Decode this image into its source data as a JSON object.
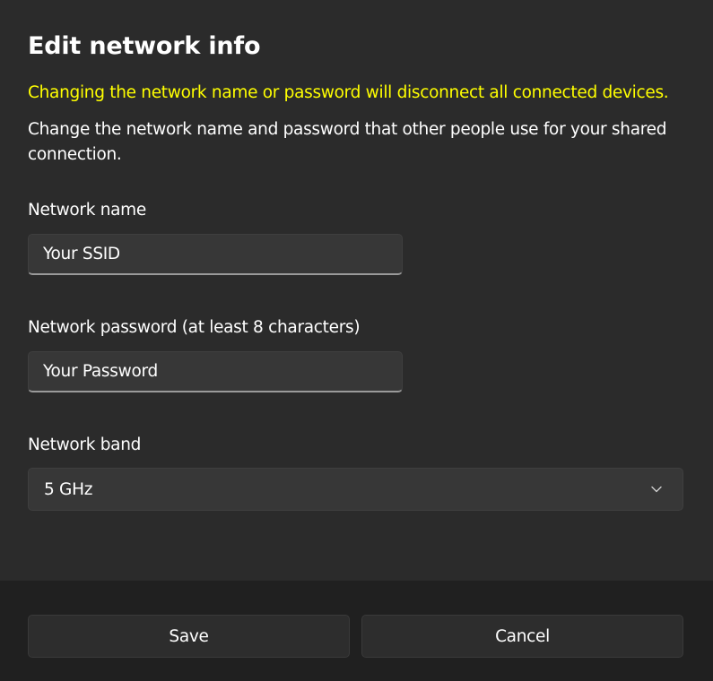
{
  "dialog": {
    "title": "Edit network info",
    "warning": "Changing the network name or password will disconnect all connected devices.",
    "description": "Change the network name and password that other people use for your shared connection."
  },
  "fields": {
    "network_name": {
      "label": "Network name",
      "value": "Your SSID"
    },
    "network_password": {
      "label": "Network password (at least 8 characters)",
      "value": "Your Password"
    },
    "network_band": {
      "label": "Network band",
      "selected": "5 GHz",
      "icon": "chevron-down-icon"
    }
  },
  "footer": {
    "save_label": "Save",
    "cancel_label": "Cancel"
  },
  "colors": {
    "background": "#2b2b2b",
    "footer_background": "#202020",
    "warning": "#ffff00",
    "text": "#ffffff",
    "input_background": "#373737"
  }
}
